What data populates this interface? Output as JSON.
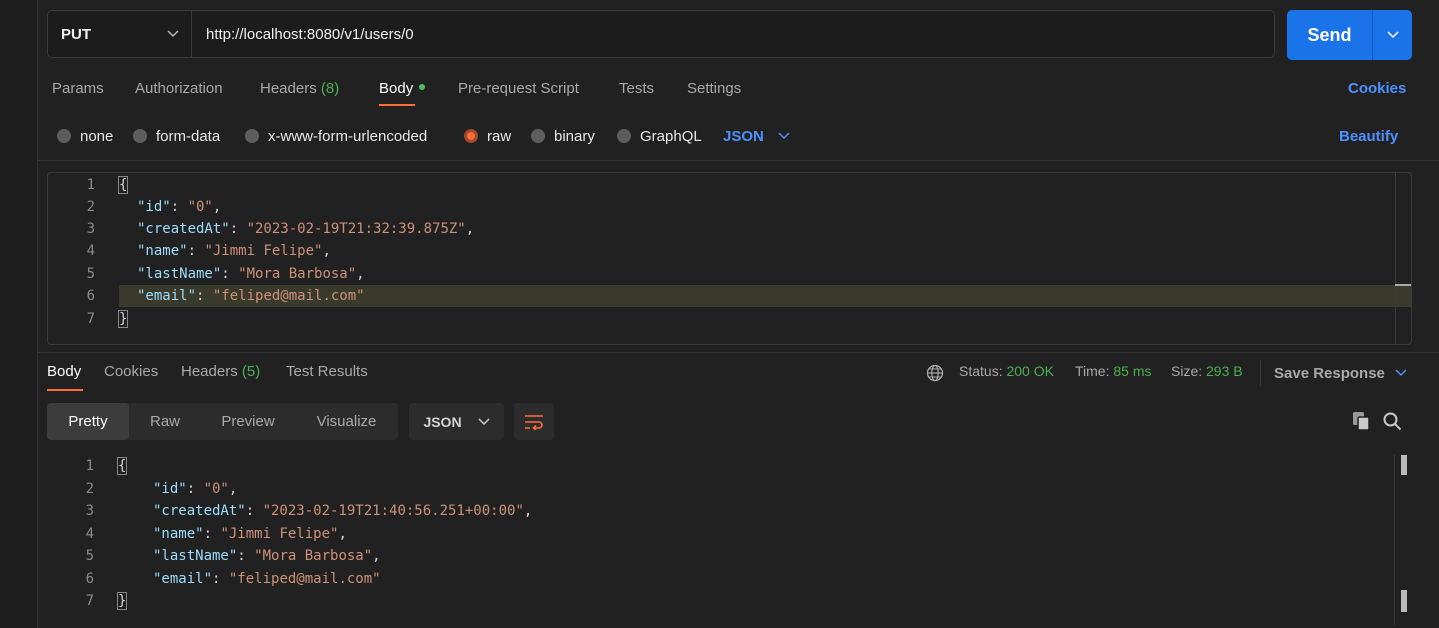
{
  "request": {
    "method": "PUT",
    "url": "http://localhost:8080/v1/users/0",
    "send_label": "Send"
  },
  "request_tabs": {
    "params": "Params",
    "authorization": "Authorization",
    "headers": "Headers",
    "headers_count": "(8)",
    "body": "Body",
    "pre_request": "Pre-request Script",
    "tests": "Tests",
    "settings": "Settings",
    "cookies": "Cookies"
  },
  "body_types": {
    "none": "none",
    "form_data": "form-data",
    "urlencoded": "x-www-form-urlencoded",
    "raw": "raw",
    "binary": "binary",
    "graphql": "GraphQL",
    "language": "JSON",
    "beautify": "Beautify"
  },
  "request_body": {
    "line_numbers": [
      "1",
      "2",
      "3",
      "4",
      "5",
      "6",
      "7"
    ],
    "open": "{",
    "close": "}",
    "fields": [
      {
        "key": "\"id\"",
        "value": "\"0\"",
        "trail": ","
      },
      {
        "key": "\"createdAt\"",
        "value": "\"2023-02-19T21:32:39.875Z\"",
        "trail": ","
      },
      {
        "key": "\"name\"",
        "value": "\"Jimmi Felipe\"",
        "trail": ","
      },
      {
        "key": "\"lastName\"",
        "value": "\"Mora Barbosa\"",
        "trail": ","
      },
      {
        "key": "\"email\"",
        "value": "\"feliped@mail.com\"",
        "trail": ""
      }
    ]
  },
  "response_tabs": {
    "body": "Body",
    "cookies": "Cookies",
    "headers": "Headers",
    "headers_count": "(5)",
    "test_results": "Test Results"
  },
  "response_status": {
    "status_label": "Status:",
    "status_value": "200 OK",
    "time_label": "Time:",
    "time_value": "85 ms",
    "size_label": "Size:",
    "size_value": "293 B",
    "save_response": "Save Response"
  },
  "response_view": {
    "pretty": "Pretty",
    "raw": "Raw",
    "preview": "Preview",
    "visualize": "Visualize",
    "format": "JSON"
  },
  "response_body": {
    "line_numbers": [
      "1",
      "2",
      "3",
      "4",
      "5",
      "6",
      "7"
    ],
    "open": "{",
    "close": "}",
    "fields": [
      {
        "key": "\"id\"",
        "value": "\"0\"",
        "trail": ","
      },
      {
        "key": "\"createdAt\"",
        "value": "\"2023-02-19T21:40:56.251+00:00\"",
        "trail": ","
      },
      {
        "key": "\"name\"",
        "value": "\"Jimmi Felipe\"",
        "trail": ","
      },
      {
        "key": "\"lastName\"",
        "value": "\"Mora Barbosa\"",
        "trail": ","
      },
      {
        "key": "\"email\"",
        "value": "\"feliped@mail.com\"",
        "trail": ""
      }
    ]
  },
  "colors": {
    "accent": "#ff6c37",
    "send": "#1a73e8",
    "success": "#4caf50",
    "link": "#4d90fe"
  }
}
